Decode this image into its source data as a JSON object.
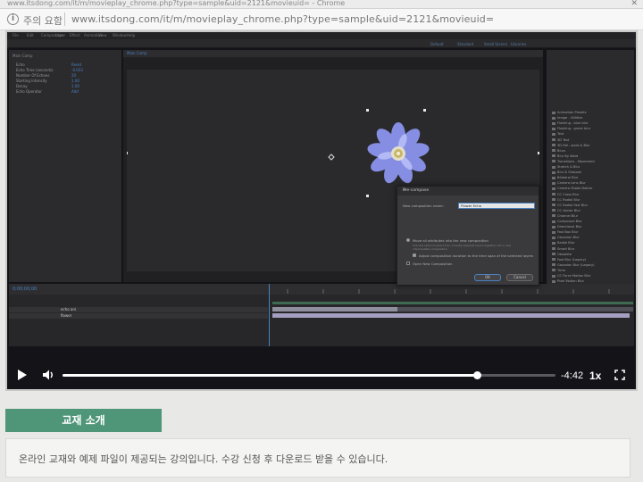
{
  "window": {
    "title": "www.itsdong.com/it/m/movieplay_chrome.php?type=sample&uid=2121&movieuid= - Chrome",
    "close_label": "✕"
  },
  "addressbar": {
    "security_label": "주의 요함",
    "url": "www.itsdong.com/it/m/movieplay_chrome.php?type=sample&uid=2121&movieuid="
  },
  "player": {
    "progress_fraction": 0.84,
    "time_remaining": "-4:42",
    "speed_label": "1x",
    "accent_color": "#ffffff"
  },
  "video": {
    "menu_items": [
      "File",
      "Edit",
      "Composition",
      "Layer",
      "Effect",
      "Animation",
      "View",
      "Window",
      "Help"
    ],
    "workspaces": [
      "Default",
      "Standard",
      "Small Screen",
      "Libraries"
    ],
    "comp_tab": "Main Comp",
    "timecode": "0;00;00;00",
    "left_props": [
      {
        "label": "Echo",
        "value": "Reset"
      },
      {
        "label": "Echo Time (seconds)",
        "value": "-0.033"
      },
      {
        "label": "Number Of Echoes",
        "value": "20"
      },
      {
        "label": "Starting Intensity",
        "value": "1.00"
      },
      {
        "label": "Decay",
        "value": "1.00"
      },
      {
        "label": "Echo Operator",
        "value": "Add"
      }
    ],
    "effects": [
      "Animation Presets",
      "Image - Utilities",
      "Flashing - blue blur",
      "Flashing - green blur",
      "Text",
      "3D Text",
      "3D Fall...ward & Blur",
      "Blurs",
      "Blur By Word",
      "Transitions - Movement",
      "Stretch & Blur",
      "Blur & Sharpen",
      "Bilateral Blur",
      "Camera Lens Blur",
      "Camera Shake Deblur",
      "CC Cross Blur",
      "CC Radial Blur",
      "CC Radial Fast Blur",
      "CC Vector Blur",
      "Channel Blur",
      "Compound Blur",
      "Directional Blur",
      "Fast Box Blur",
      "Gaussian Blur",
      "Radial Blur",
      "Smart Blur",
      "Obsolete",
      "Fast Blur (Legacy)",
      "Gaussian Blur (Legacy)",
      "Time",
      "CC Force Motion Blur",
      "Pixel Motion Blur"
    ],
    "layers": [
      {
        "name": "echo ani",
        "mode": "Normal",
        "parent": "None"
      },
      {
        "name": "flower",
        "mode": "Normal",
        "parent": "None"
      }
    ],
    "dialog": {
      "title": "Pre-compose",
      "name_label": "New composition name:",
      "name_value": "Flower Echo",
      "option1": "Move all attributes into the new composition",
      "option1_hint": "Use this option to place the currently selected layers together into a new intermediate composition.",
      "option2": "Adjust composition duration to the time span of the selected layers",
      "option3": "Open New Composition",
      "ok_label": "OK",
      "cancel_label": "Cancel"
    }
  },
  "section": {
    "tab_label": "교재 소개",
    "description": "온라인 교재와 예제 파일이 제공되는 강의입니다. 수강 신청 후 다운로드 받을 수 있습니다."
  }
}
